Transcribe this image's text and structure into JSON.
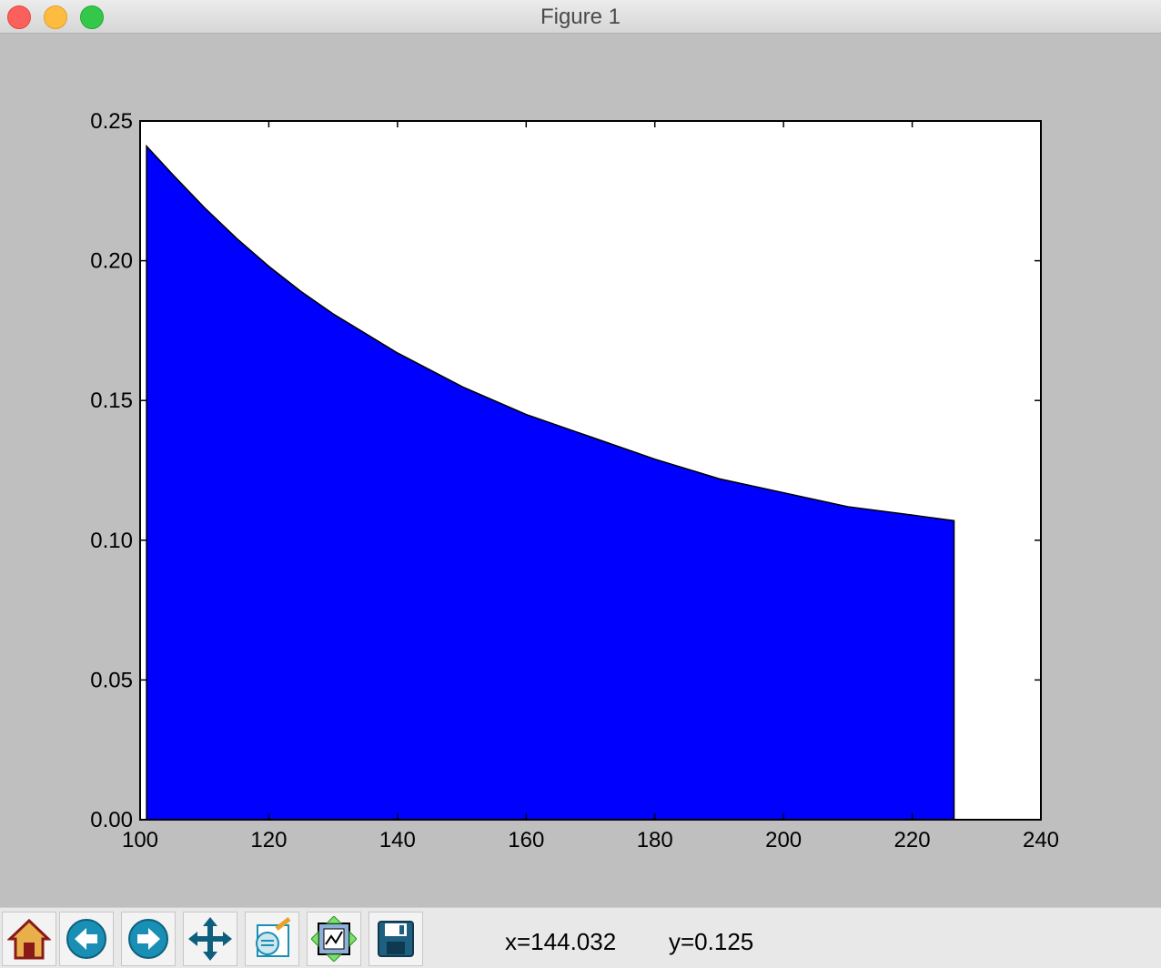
{
  "window": {
    "title": "Figure 1"
  },
  "toolbar": {
    "buttons": [
      {
        "name": "home-button",
        "icon": "home-icon"
      },
      {
        "name": "back-button",
        "icon": "back-arrow-icon"
      },
      {
        "name": "forward-button",
        "icon": "forward-arrow-icon"
      },
      {
        "name": "pan-button",
        "icon": "pan-icon"
      },
      {
        "name": "zoom-button",
        "icon": "zoom-rect-icon"
      },
      {
        "name": "subplots-button",
        "icon": "subplots-icon"
      },
      {
        "name": "save-button",
        "icon": "save-icon"
      }
    ],
    "x_readout": "x=144.032",
    "y_readout": "y=0.125"
  },
  "chart_data": {
    "type": "area",
    "title": "",
    "xlabel": "",
    "ylabel": "",
    "xlim": [
      100,
      240
    ],
    "ylim": [
      0,
      0.25
    ],
    "xticks": [
      "100",
      "120",
      "140",
      "160",
      "180",
      "200",
      "220",
      "240"
    ],
    "yticks": [
      "0.00",
      "0.05",
      "0.10",
      "0.15",
      "0.20",
      "0.25"
    ],
    "grid": false,
    "fill_color": "#0000ff",
    "series": [
      {
        "x": [
          101,
          105,
          110,
          115,
          120,
          125,
          130,
          140,
          150,
          160,
          170,
          180,
          190,
          200,
          210,
          220,
          226.5
        ],
        "y": [
          0.241,
          0.231,
          0.219,
          0.208,
          0.198,
          0.189,
          0.181,
          0.167,
          0.155,
          0.145,
          0.137,
          0.129,
          0.122,
          0.117,
          0.112,
          0.109,
          0.107
        ]
      }
    ]
  }
}
